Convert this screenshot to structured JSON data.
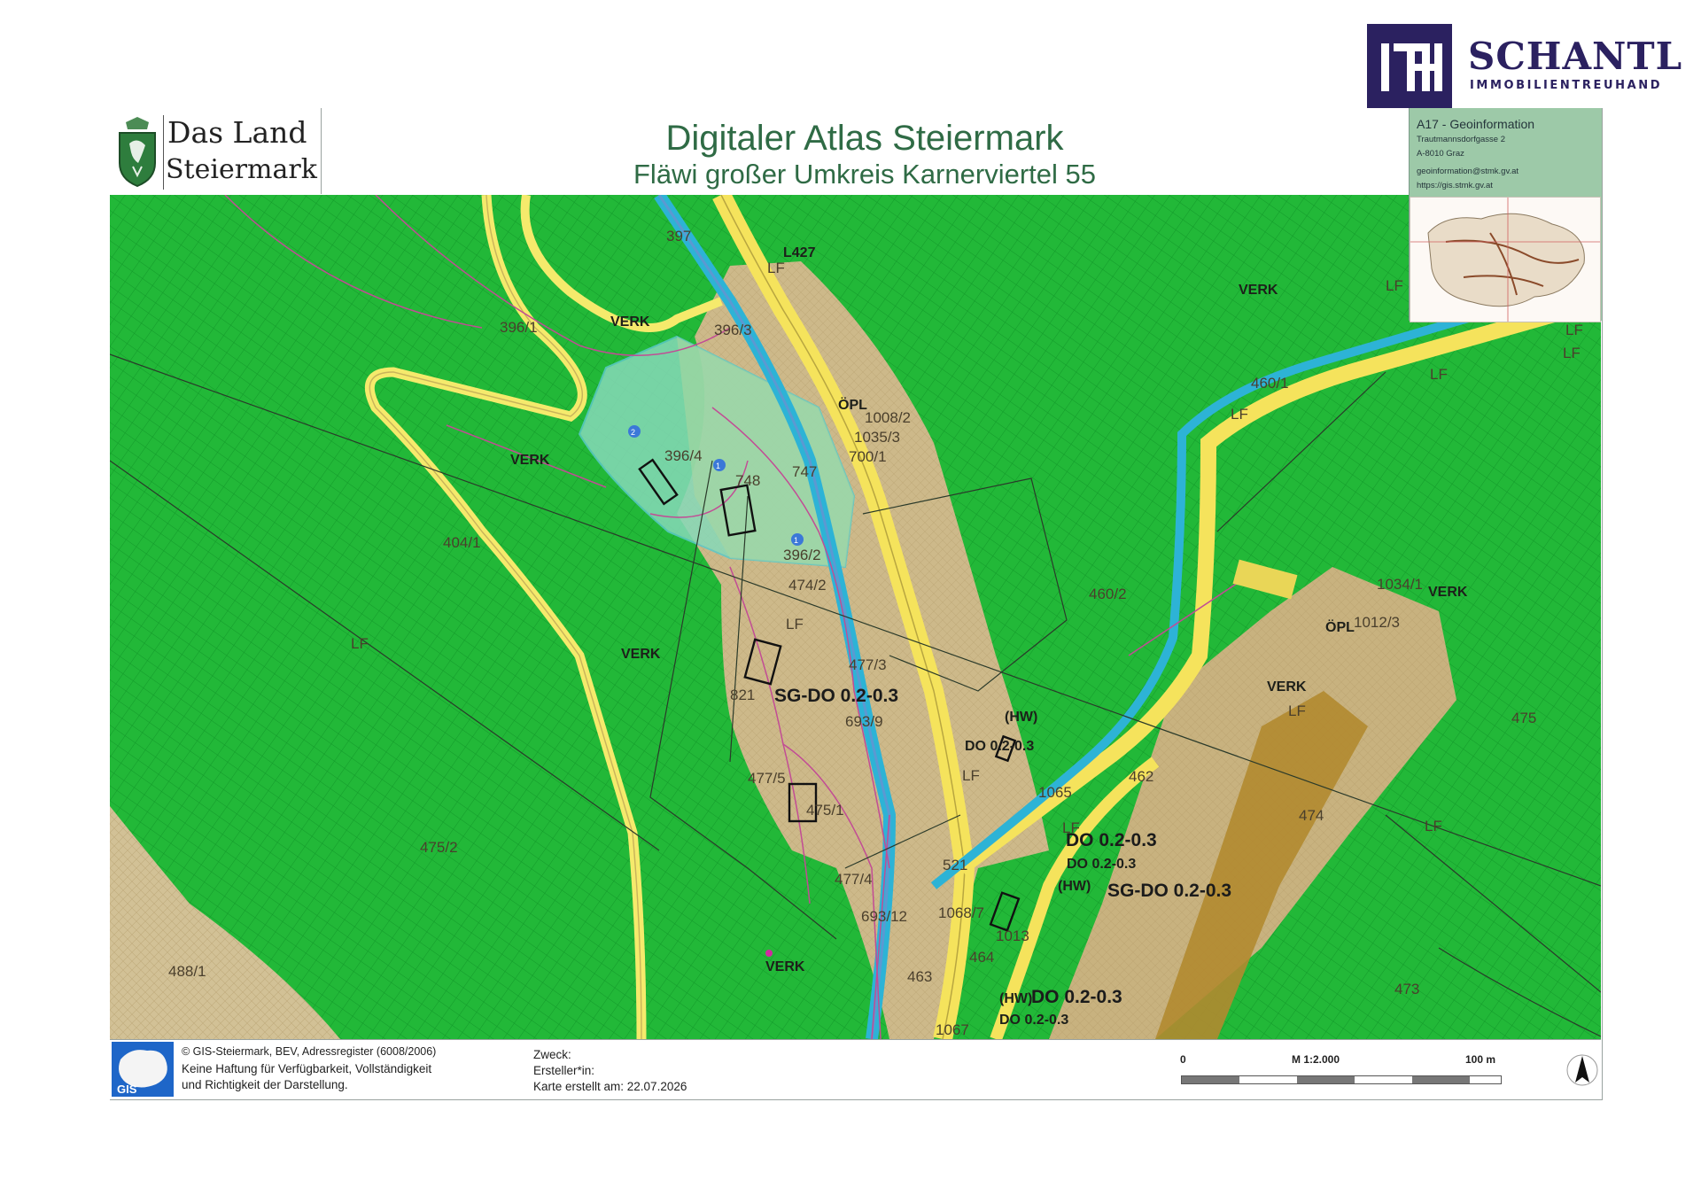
{
  "brand": {
    "name": "SCHANTL",
    "tagline": "IMMOBILIENTREUHAND",
    "monogram": "ITH"
  },
  "header": {
    "land_line1": "Das Land",
    "land_line2": "Steiermark",
    "title": "Digitaler Atlas Steiermark",
    "subtitle": "Fläwi großer Umkreis Karnerviertel 55"
  },
  "info": {
    "heading": "A17 - Geoinformation",
    "lines": [
      "Trautmannsdorfgasse 2",
      "A-8010 Graz",
      "geoinformation@stmk.gv.at",
      "https://gis.stmk.gv.at"
    ]
  },
  "map": {
    "colors": {
      "forest": "#1fb635",
      "forest_grid": "#0f8a22",
      "building_land": "#c7b48a",
      "dark_building": "#a8862e",
      "road_yellow": "#f3e66a",
      "water_blue": "#2fb7d6",
      "plot_highlight": "#7fd9b1",
      "boundary": "#c4488e"
    },
    "labels": {
      "p397": "397",
      "p396_1": "396/1",
      "p396_3": "396/3",
      "verk1": "VERK",
      "lf1": "LF",
      "l427": "L427",
      "p460_1": "460/1",
      "lf2": "LF",
      "lf3": "LF",
      "lf4": "LF",
      "p1008_2": "1008/2",
      "p1035_3": "1035/3",
      "p700_1": "700/1",
      "opl1": "ÖPL",
      "verk2": "VERK",
      "p747": "747",
      "p748": "748",
      "p396_4": "396/4",
      "p396_2": "396/2",
      "p404_1": "404/1",
      "lf5": "LF",
      "lf6": "LF",
      "verk3": "VERK",
      "p474_2": "474/2",
      "p460_2": "460/2",
      "p1034_1": "1034/1",
      "verk4": "VERK",
      "opl2": "ÖPL",
      "p1012_3": "1012/3",
      "p477_3": "477/3",
      "p821": "821",
      "sgdo1": "SG-DO 0.2-0.3",
      "hw1": "(HW)",
      "p693_9": "693/9",
      "do1": "DO 0.2-0.3",
      "verk5": "VERK",
      "lf7": "LF",
      "p475": "475",
      "p477_5": "477/5",
      "lf8": "LF",
      "p1065": "1065",
      "p462": "462",
      "p474": "474",
      "p475_2": "475/2",
      "p475_1": "475/1",
      "lf9": "LF",
      "do2": "DO 0.2-0.3",
      "do3": "DO 0.2-0.3",
      "lf10": "LF",
      "p477_4": "477/4",
      "p521": "521",
      "hw2": "(HW)",
      "sgdo2": "SG-DO 0.2-0.3",
      "p1068_7": "1068/7",
      "p1013": "1013",
      "p464": "464",
      "p693_12": "693/12",
      "p463": "463",
      "verk6": "VERK",
      "p488_1": "488/1",
      "do4": "DO 0.2-0.3",
      "hw3": "(HW)",
      "p1067": "1067",
      "do5": "DO 0.2-0.3",
      "p473": "473",
      "verk7": "VERK",
      "lf11": "LF",
      "lf12": "LF",
      "markers": [
        "1",
        "1",
        "2"
      ]
    }
  },
  "footer": {
    "copyright": "© GIS-Steiermark, BEV, Adressregister (6008/2006)",
    "disclaimer1": "Keine Haftung für Verfügbarkeit, Vollständigkeit",
    "disclaimer2": "und Richtigkeit der Darstellung.",
    "purpose_label": "Zweck:",
    "creator_label": "Ersteller*in:",
    "created_label": "Karte erstellt am: 22.07.2026",
    "scale_zero": "0",
    "scale_text": "M 1:2.000",
    "scale_end": "100 m",
    "gis_text": "GIS"
  }
}
